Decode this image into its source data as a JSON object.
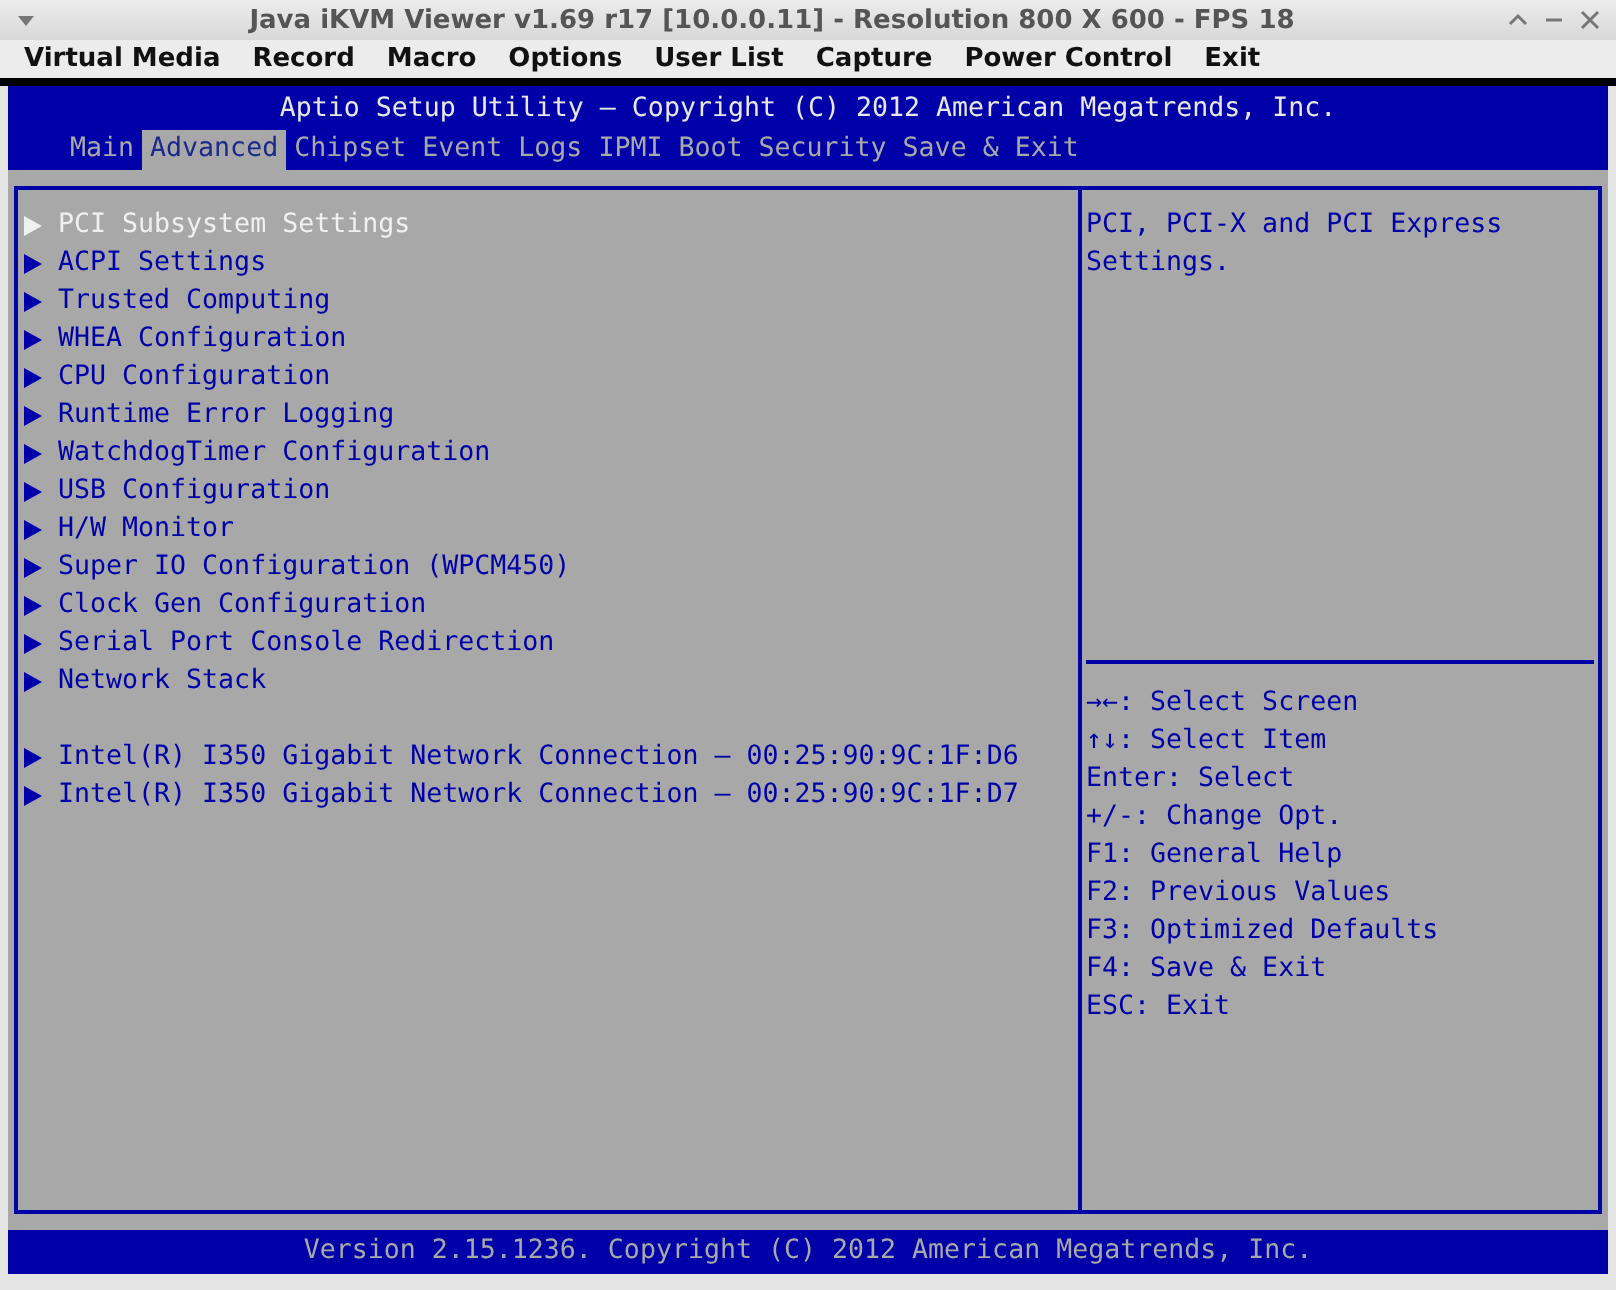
{
  "window": {
    "title": "Java iKVM Viewer v1.69 r17 [10.0.0.11]  - Resolution 800 X 600 - FPS 18"
  },
  "menu": [
    "Virtual Media",
    "Record",
    "Macro",
    "Options",
    "User List",
    "Capture",
    "Power Control",
    "Exit"
  ],
  "bios": {
    "title": "Aptio Setup Utility – Copyright (C) 2012 American Megatrends, Inc.",
    "tabs": [
      {
        "label": "Main",
        "selected": false
      },
      {
        "label": "Advanced",
        "selected": true
      },
      {
        "label": "Chipset",
        "selected": false
      },
      {
        "label": "Event Logs",
        "selected": false
      },
      {
        "label": "IPMI",
        "selected": false
      },
      {
        "label": "Boot",
        "selected": false
      },
      {
        "label": "Security",
        "selected": false
      },
      {
        "label": "Save & Exit",
        "selected": false
      }
    ],
    "items": [
      {
        "label": "PCI Subsystem Settings",
        "selected": true
      },
      {
        "label": "ACPI Settings",
        "selected": false
      },
      {
        "label": "Trusted Computing",
        "selected": false
      },
      {
        "label": "WHEA Configuration",
        "selected": false
      },
      {
        "label": "CPU Configuration",
        "selected": false
      },
      {
        "label": "Runtime Error Logging",
        "selected": false
      },
      {
        "label": "WatchdogTimer Configuration",
        "selected": false
      },
      {
        "label": "USB Configuration",
        "selected": false
      },
      {
        "label": "H/W Monitor",
        "selected": false
      },
      {
        "label": "Super IO Configuration (WPCM450)",
        "selected": false
      },
      {
        "label": "Clock Gen Configuration",
        "selected": false
      },
      {
        "label": "Serial Port Console Redirection",
        "selected": false
      },
      {
        "label": "Network Stack",
        "selected": false
      }
    ],
    "network_items": [
      {
        "label": "Intel(R) I350 Gigabit Network Connection – 00:25:90:9C:1F:D6",
        "selected": false
      },
      {
        "label": "Intel(R) I350 Gigabit Network Connection – 00:25:90:9C:1F:D7",
        "selected": false
      }
    ],
    "help": [
      "PCI, PCI-X and PCI Express",
      "Settings."
    ],
    "keys": [
      "→←: Select Screen",
      "↑↓: Select Item",
      "Enter: Select",
      "+/-: Change Opt.",
      "F1: General Help",
      "F2: Previous Values",
      "F3: Optimized Defaults",
      "F4: Save & Exit",
      "ESC: Exit"
    ],
    "footer": "Version 2.15.1236. Copyright (C) 2012 American Megatrends, Inc."
  }
}
